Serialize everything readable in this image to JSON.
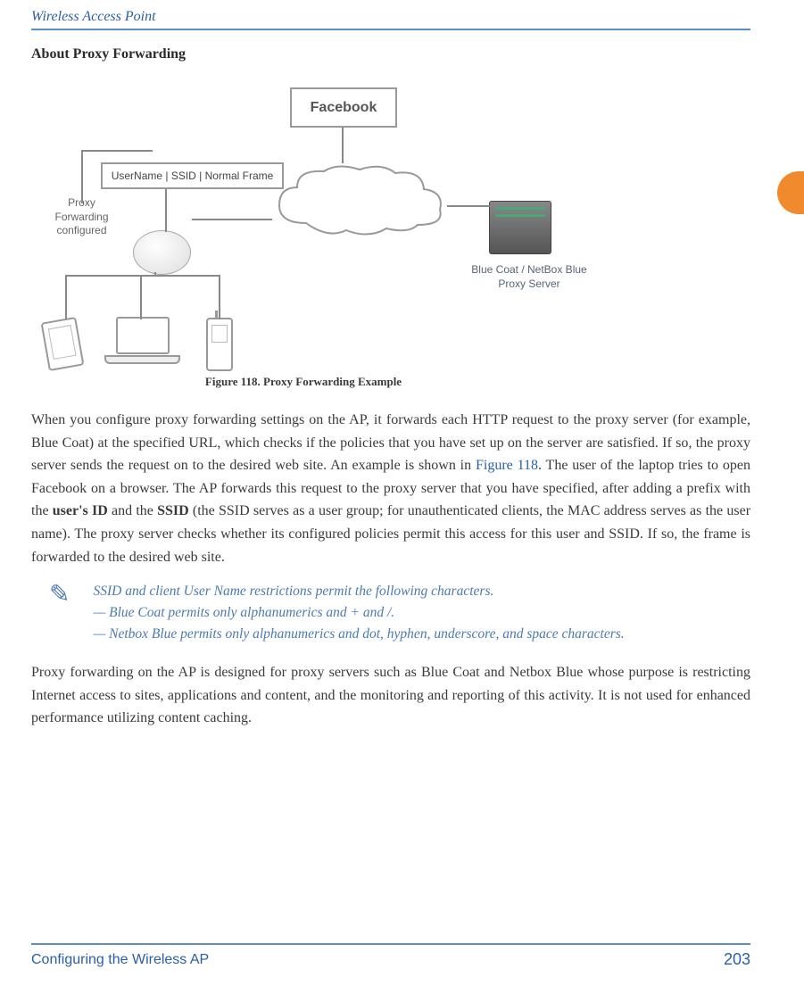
{
  "header": {
    "title": "Wireless Access Point"
  },
  "section": {
    "heading": "About Proxy Forwarding"
  },
  "figure": {
    "facebook_label": "Facebook",
    "frame_label": "UserName | SSID | Normal Frame",
    "proxy_config_label": "Proxy Forwarding configured",
    "proxy_server_label": "Blue Coat / NetBox Blue Proxy Server",
    "caption": "Figure 118. Proxy Forwarding Example"
  },
  "paragraphs": {
    "p1_part1": "When you configure proxy forwarding settings on the AP, it forwards each HTTP request to the proxy server (for example, Blue Coat) at the specified URL, which checks if the policies that you have set up on the server are satisfied. If so, the proxy server sends the request on to the desired web site. An example is shown in ",
    "p1_link": "Figure 118",
    "p1_part2": ". The user of the laptop tries to open Facebook on a browser. The AP forwards this request to the proxy server that you have specified, after adding a prefix with the ",
    "p1_bold1": "user's ID",
    "p1_part3": " and the ",
    "p1_bold2": "SSID",
    "p1_part4": " (the SSID serves as a user group; for unauthenticated clients, the MAC address serves as the user name). The proxy server checks whether its configured policies permit this access for this user and SSID. If so, the frame is forwarded to the desired web site.",
    "p2": "Proxy forwarding on the AP is designed for proxy servers such as Blue Coat and Netbox Blue whose purpose is restricting Internet access to sites, applications and content, and the monitoring and reporting of this activity. It is not used for enhanced performance utilizing content caching."
  },
  "note": {
    "icon": "✎",
    "line1": "SSID and client User Name restrictions permit the following characters.",
    "line2": "— Blue Coat permits only alphanumerics and + and /.",
    "line3": "— Netbox Blue permits only alphanumerics and dot, hyphen, underscore, and space characters."
  },
  "footer": {
    "left": "Configuring the Wireless AP",
    "page": "203"
  }
}
